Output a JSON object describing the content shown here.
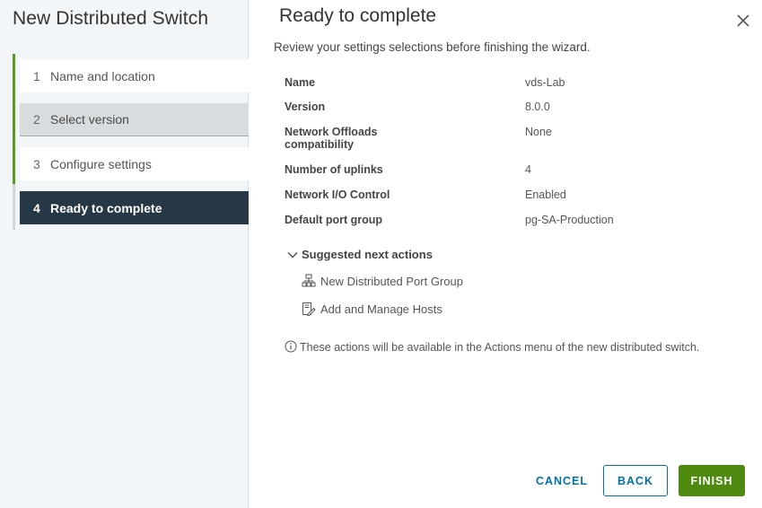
{
  "wizard": {
    "title": "New Distributed Switch",
    "steps": [
      {
        "num": "1",
        "label": "Name and location",
        "state": "completed"
      },
      {
        "num": "2",
        "label": "Select version",
        "state": "visited"
      },
      {
        "num": "3",
        "label": "Configure settings",
        "state": "completed"
      },
      {
        "num": "4",
        "label": "Ready to complete",
        "state": "current"
      }
    ]
  },
  "page": {
    "title": "Ready to complete",
    "subtitle": "Review your settings selections before finishing the wizard."
  },
  "summary": [
    {
      "key": "Name",
      "value": "vds-Lab"
    },
    {
      "key": "Version",
      "value": "8.0.0"
    },
    {
      "key": "Network Offloads compatibility",
      "key_line1": "Network Offloads",
      "key_line2": "compatibility",
      "value": "None"
    },
    {
      "key": "Number of uplinks",
      "value": "4"
    },
    {
      "key": "Network I/O Control",
      "value": "Enabled"
    },
    {
      "key": "Default port group",
      "value": "pg-SA-Production"
    }
  ],
  "next_actions": {
    "header": "Suggested next actions",
    "expanded": true,
    "items": [
      {
        "label": "New Distributed Port Group",
        "icon": "port-group-icon"
      },
      {
        "label": "Add and Manage Hosts",
        "icon": "manage-hosts-icon"
      }
    ]
  },
  "info": {
    "icon": "info-icon",
    "text": "These actions will be available in the Actions menu of the new distributed switch."
  },
  "footer": {
    "cancel": "CANCEL",
    "back": "BACK",
    "finish": "FINISH"
  },
  "colors": {
    "accent_green": "#4f8a10",
    "link_blue": "#0072a3",
    "current_step_bg": "#263845",
    "progress_green": "#5b9a1e"
  }
}
